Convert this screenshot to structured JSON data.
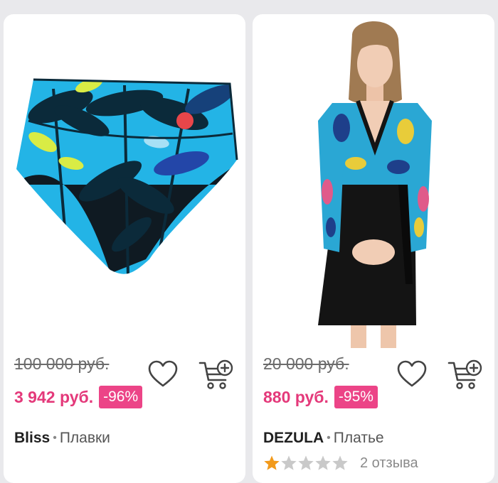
{
  "products": [
    {
      "old_price": "100 000 руб.",
      "price": "3 942 руб.",
      "discount": "-96%",
      "brand": "Bliss",
      "separator": "•",
      "category": "Плавки",
      "image": "patterned-swim-briefs",
      "colors": {
        "print_primary": "#23b4e6",
        "print_dark": "#0b2a3a",
        "print_accent": "#d9ec45"
      }
    },
    {
      "old_price": "20 000 руб.",
      "price": "880 руб.",
      "discount": "-95%",
      "brand": "DEZULA",
      "separator": "•",
      "category": "Платье",
      "image": "wrap-dress-model",
      "rating": 1,
      "rating_max": 5,
      "reviews": "2 отзыва",
      "colors": {
        "dress_dark": "#141414",
        "print_primary": "#2aa7d4"
      }
    }
  ],
  "icons": {
    "favorite": "heart-outline-icon",
    "add_to_cart": "cart-plus-icon",
    "rating": "star-icon"
  },
  "colors": {
    "price": "#e4397a",
    "badge": "#ec4487",
    "star_filled": "#f29a1b",
    "star_empty": "#c9c9c9"
  }
}
